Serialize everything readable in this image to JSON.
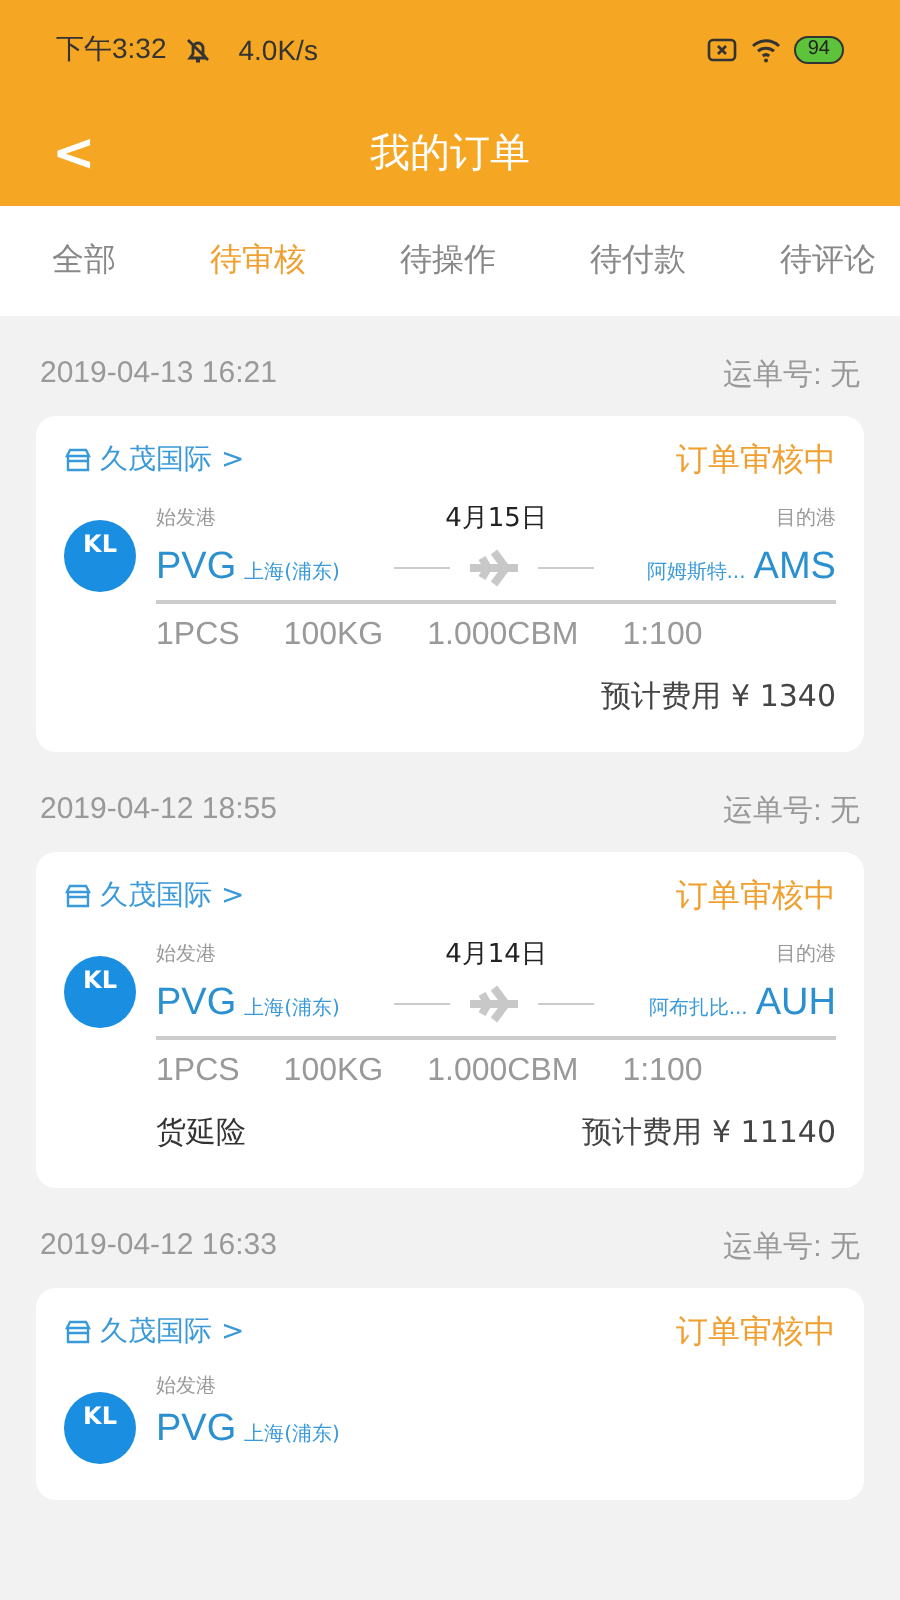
{
  "status_bar": {
    "time": "下午3:32",
    "speed": "4.0K/s",
    "battery": "94"
  },
  "header": {
    "back": "<",
    "title": "我的订单"
  },
  "tabs": [
    {
      "label": "全部",
      "selected": false
    },
    {
      "label": "待审核",
      "selected": true
    },
    {
      "label": "待操作",
      "selected": false
    },
    {
      "label": "待付款",
      "selected": false
    },
    {
      "label": "待评论",
      "selected": false
    }
  ],
  "orders": [
    {
      "date": "2019-04-13 16:21",
      "waybill": "运单号: 无",
      "company": "久茂国际 >",
      "status": "订单审核中",
      "logo": "KL",
      "origin_label": "始发港",
      "flight_date": "4月15日",
      "dest_label": "目的港",
      "origin_code": "PVG",
      "origin_city": "上海(浦东)",
      "dest_city": "阿姆斯特...",
      "dest_code": "AMS",
      "specs": [
        "1PCS",
        "100KG",
        "1.000CBM",
        "1:100"
      ],
      "fee": "预计费用 ¥ 1340"
    },
    {
      "date": "2019-04-12 18:55",
      "waybill": "运单号: 无",
      "company": "久茂国际 >",
      "status": "订单审核中",
      "logo": "KL",
      "origin_label": "始发港",
      "flight_date": "4月14日",
      "dest_label": "目的港",
      "origin_code": "PVG",
      "origin_city": "上海(浦东)",
      "dest_city": "阿布扎比...",
      "dest_code": "AUH",
      "specs": [
        "1PCS",
        "100KG",
        "1.000CBM",
        "1:100"
      ],
      "insurance": "货延险",
      "fee": "预计费用 ¥ 11140"
    },
    {
      "date": "2019-04-12 16:33",
      "waybill": "运单号: 无",
      "company": "久茂国际 >",
      "status": "订单审核中",
      "logo": "KL",
      "origin_label": "始发港",
      "origin_code": "PVG",
      "origin_city": "上海(浦东)"
    }
  ]
}
